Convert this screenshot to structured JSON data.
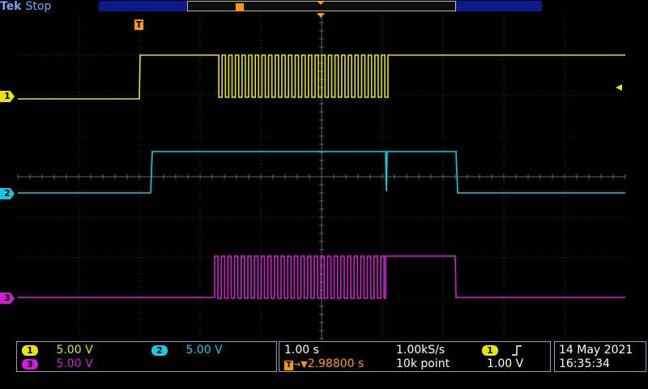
{
  "header": {
    "brand": "Tek",
    "status": "Stop"
  },
  "markers": {
    "trigger_marker": "T",
    "ch1_label": "1",
    "ch2_label": "2",
    "ch3_label": "3"
  },
  "channels": [
    {
      "label": "1",
      "scale": "5.00 V",
      "color": "#e6e600"
    },
    {
      "label": "2",
      "scale": "5.00 V",
      "color": "#19c8e6"
    },
    {
      "label": "3",
      "scale": "5.00 V",
      "color": "#d21ed2"
    }
  ],
  "timebase": {
    "time_div": "1.00 s",
    "sample_rate": "1.00kS/s",
    "trigger_position": "2.98800 s",
    "record_length": "10k point"
  },
  "trigger": {
    "source": "1",
    "slope_icon": "rising-edge-icon",
    "level": "1.00 V"
  },
  "datetime": {
    "date": "14 May 2021",
    "time": "16:35:34"
  }
}
